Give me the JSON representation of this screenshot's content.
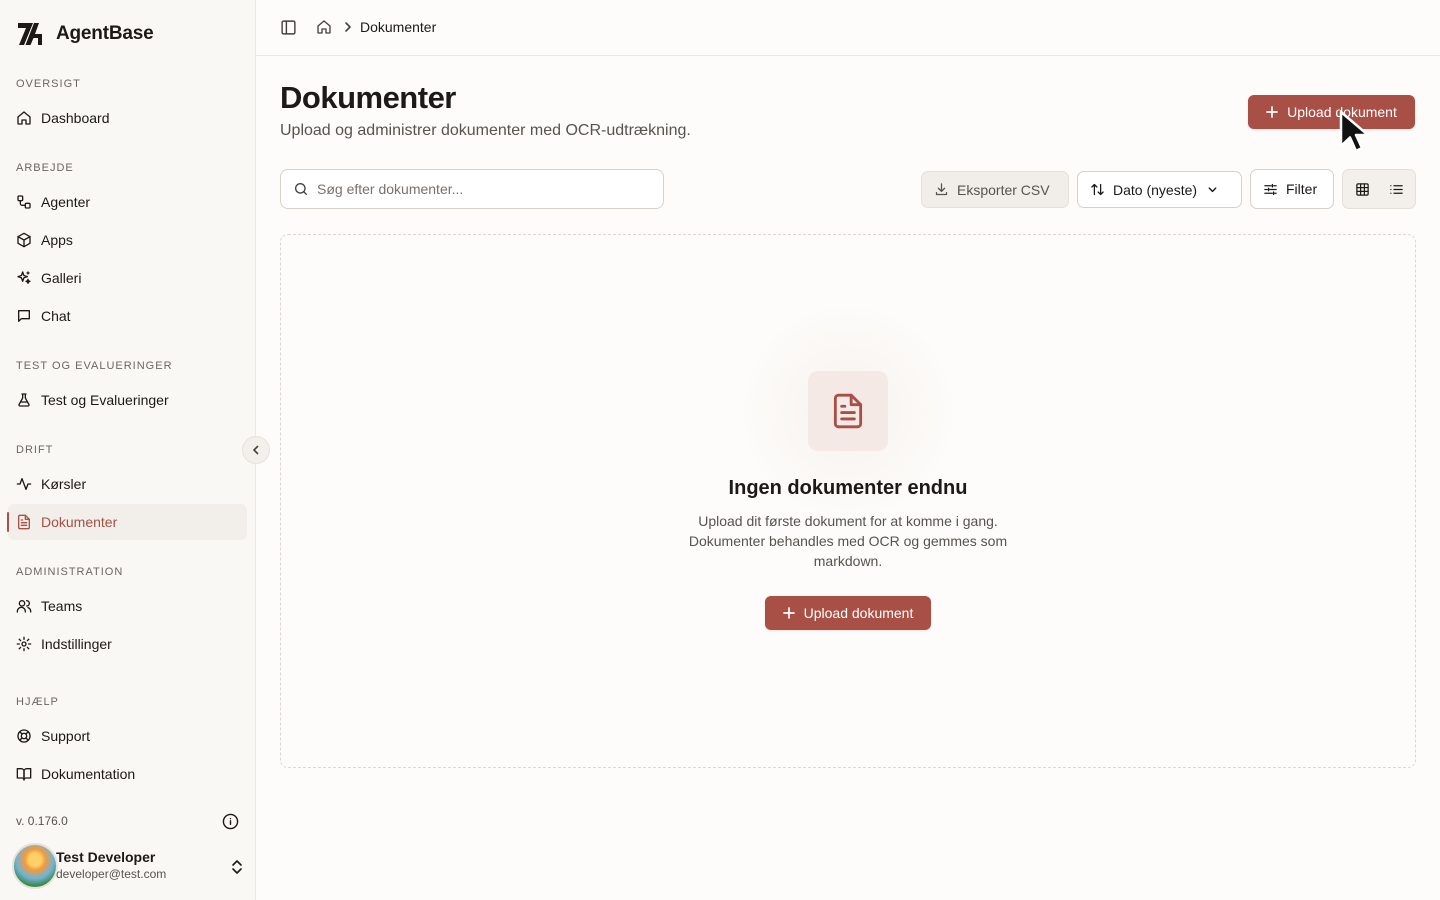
{
  "brand": {
    "name": "AgentBase"
  },
  "sidebar": {
    "sections": [
      {
        "label": "OVERSIGT",
        "items": [
          {
            "label": "Dashboard",
            "icon": "home-icon"
          }
        ]
      },
      {
        "label": "ARBEJDE",
        "items": [
          {
            "label": "Agenter",
            "icon": "workflow-icon"
          },
          {
            "label": "Apps",
            "icon": "box-icon"
          },
          {
            "label": "Galleri",
            "icon": "sparkles-icon"
          },
          {
            "label": "Chat",
            "icon": "message-icon"
          }
        ]
      },
      {
        "label": "TEST OG EVALUERINGER",
        "items": [
          {
            "label": "Test og Evalueringer",
            "icon": "flask-icon"
          }
        ]
      },
      {
        "label": "DRIFT",
        "items": [
          {
            "label": "Kørsler",
            "icon": "activity-icon"
          },
          {
            "label": "Dokumenter",
            "icon": "file-text-icon",
            "active": true
          }
        ]
      },
      {
        "label": "ADMINISTRATION",
        "items": [
          {
            "label": "Teams",
            "icon": "users-icon"
          },
          {
            "label": "Indstillinger",
            "icon": "gear-icon"
          }
        ]
      },
      {
        "label": "HJÆLP",
        "items": [
          {
            "label": "Support",
            "icon": "lifebuoy-icon"
          },
          {
            "label": "Dokumentation",
            "icon": "book-icon"
          }
        ]
      }
    ],
    "version": "v. 0.176.0",
    "user": {
      "name": "Test Developer",
      "email": "developer@test.com"
    }
  },
  "topbar": {
    "breadcrumb": "Dokumenter"
  },
  "page": {
    "title": "Dokumenter",
    "subtitle": "Upload og administrer dokumenter med OCR-udtrækning.",
    "upload_label": "Upload dokument"
  },
  "toolbar": {
    "search_placeholder": "Søg efter dokumenter...",
    "export_label": "Eksporter CSV",
    "sort_label": "Dato (nyeste)",
    "filter_label": "Filter"
  },
  "empty_state": {
    "title": "Ingen dokumenter endnu",
    "description": "Upload dit første dokument for at komme i gang. Dokumenter behandles med OCR og gemmes som markdown.",
    "button_label": "Upload dokument"
  },
  "colors": {
    "accent": "#a84f46",
    "accent_soft": "#f5e9e6",
    "background": "#fdfcfa",
    "sidebar": "#faf8f5"
  }
}
